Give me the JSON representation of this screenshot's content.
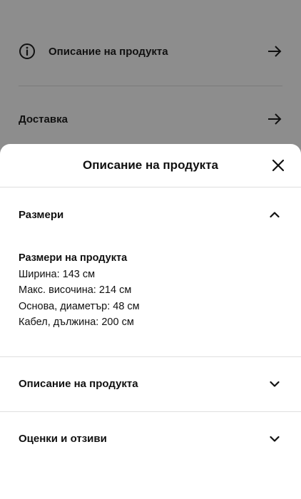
{
  "background": {
    "rows": [
      {
        "label": "Описание на продукта",
        "icon": "info-icon",
        "action_icon": "arrow-right-icon"
      },
      {
        "label": "Доставка",
        "action_icon": "arrow-right-icon"
      }
    ]
  },
  "sheet": {
    "title": "Описание на продукта",
    "close_icon": "close-icon",
    "sections": [
      {
        "title": "Размери",
        "expanded": true,
        "toggle_icon": "chevron-up-icon",
        "subtitle": "Размери на продукта",
        "lines": [
          "Ширина: 143 см",
          "Макс. височина: 214 см",
          "Основа, диаметър: 48 см",
          "Кабел, дължина: 200 см"
        ]
      },
      {
        "title": "Описание на продукта",
        "expanded": false,
        "toggle_icon": "chevron-down-icon"
      },
      {
        "title": "Оценки и отзиви",
        "expanded": false,
        "toggle_icon": "chevron-down-icon"
      }
    ]
  },
  "colors": {
    "overlay": "#8d8d8d",
    "sheet": "#ffffff",
    "divider": "#dfdfdf",
    "text": "#111111"
  }
}
